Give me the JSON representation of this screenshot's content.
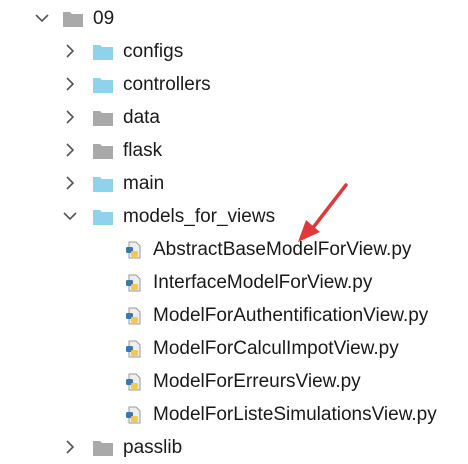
{
  "tree": {
    "root": {
      "label": "09",
      "expanded": true,
      "icon": "folder-gray-icon"
    },
    "children": [
      {
        "label": "configs",
        "icon": "folder-blue-icon",
        "expanded": false
      },
      {
        "label": "controllers",
        "icon": "folder-blue-icon",
        "expanded": false
      },
      {
        "label": "data",
        "icon": "folder-gray-icon",
        "expanded": false
      },
      {
        "label": "flask",
        "icon": "folder-gray-icon",
        "expanded": false
      },
      {
        "label": "main",
        "icon": "folder-blue-icon",
        "expanded": false
      },
      {
        "label": "models_for_views",
        "icon": "folder-blue-icon",
        "expanded": true,
        "files": [
          {
            "label": "AbstractBaseModelForView.py",
            "icon": "python-file-icon"
          },
          {
            "label": "InterfaceModelForView.py",
            "icon": "python-file-icon"
          },
          {
            "label": "ModelForAuthentificationView.py",
            "icon": "python-file-icon"
          },
          {
            "label": "ModelForCalculImpotView.py",
            "icon": "python-file-icon"
          },
          {
            "label": "ModelForErreursView.py",
            "icon": "python-file-icon"
          },
          {
            "label": "ModelForListeSimulationsView.py",
            "icon": "python-file-icon"
          }
        ]
      },
      {
        "label": "passlib",
        "icon": "folder-gray-icon",
        "expanded": false
      }
    ]
  },
  "colors": {
    "folder_blue": "#8fd2ec",
    "folder_gray": "#a9a9a9",
    "chevron": "#555555",
    "annotation_arrow": "#e0393c",
    "python_blue": "#3d76ab",
    "python_yellow": "#f4c94a"
  }
}
